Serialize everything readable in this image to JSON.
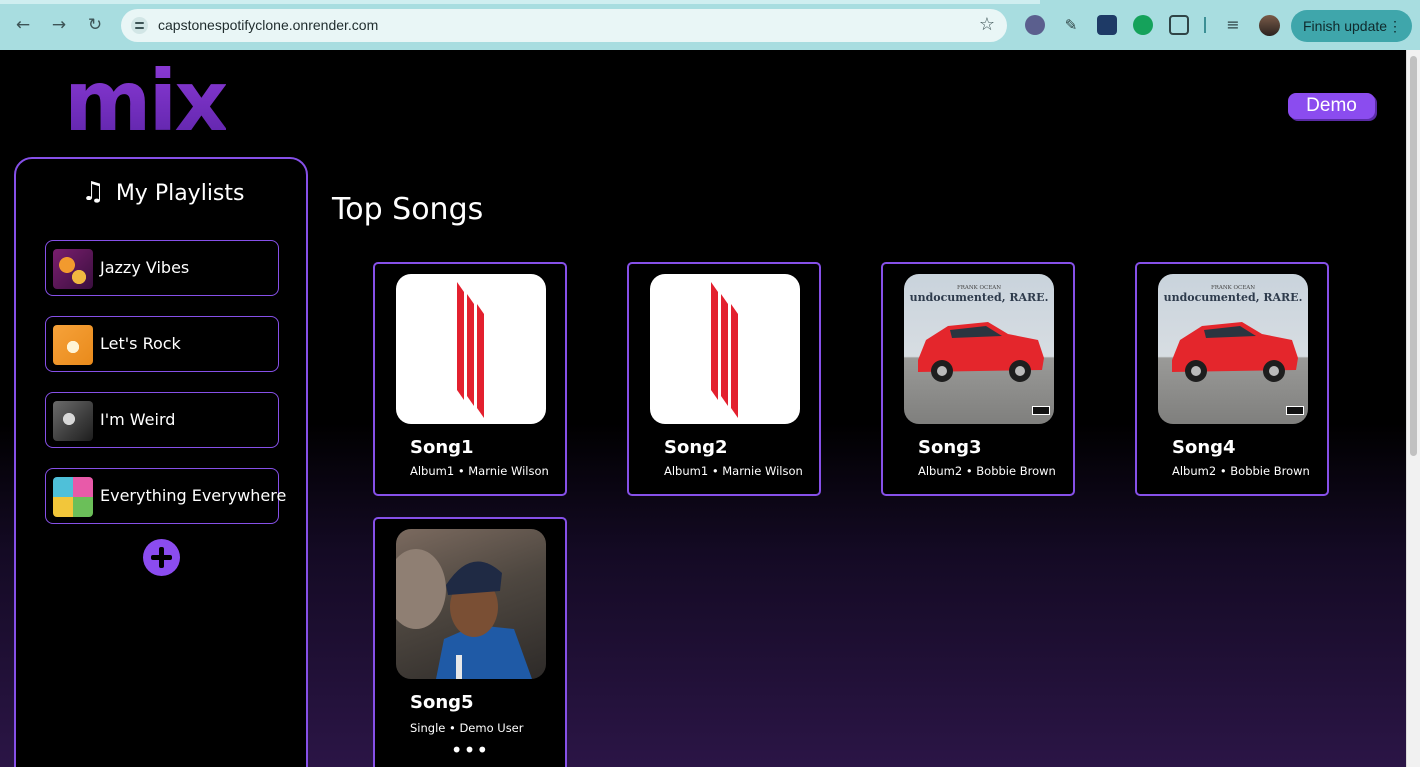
{
  "browser": {
    "url": "capstonespotifyclone.onrender.com",
    "update_label": "Finish update",
    "back_glyph": "←",
    "forward_glyph": "→",
    "reload_glyph": "↻",
    "star_glyph": "☆",
    "more_glyph": "⋮",
    "extensions": [
      "extension-icon",
      "eyedropper-icon",
      "react-devtools-icon",
      "grammarly-icon",
      "puzzle-extensions-icon",
      "media-queue-icon",
      "profile-avatar"
    ]
  },
  "app": {
    "logo": "mix",
    "user_button": "Demo",
    "accent_color": "#8b4cef"
  },
  "sidebar": {
    "title": "My Playlists",
    "playlists": [
      {
        "label": "Jazzy Vibes"
      },
      {
        "label": "Let's Rock"
      },
      {
        "label": "I'm Weird"
      },
      {
        "label": "Everything Everywhere"
      }
    ]
  },
  "main": {
    "heading": "Top Songs",
    "songs": [
      {
        "title": "Song1",
        "meta": "Album1 • Marnie Wilson"
      },
      {
        "title": "Song2",
        "meta": "Album1 • Marnie Wilson"
      },
      {
        "title": "Song3",
        "meta": "Album2 • Bobbie Brown"
      },
      {
        "title": "Song4",
        "meta": "Album2 • Bobbie Brown"
      },
      {
        "title": "Song5",
        "meta": "Single • Demo User",
        "more": "•••"
      }
    ],
    "album_art_text": {
      "artist": "FRANK OCEAN",
      "title": "undocumented, RARE."
    }
  }
}
